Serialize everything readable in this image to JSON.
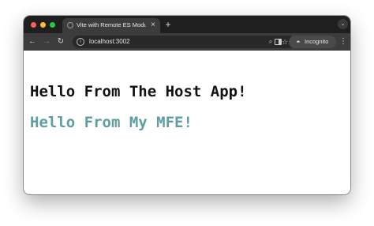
{
  "browser": {
    "tab": {
      "title": "Vite with Remote ES Modules",
      "close_glyph": "×",
      "favicon": "globe-icon"
    },
    "new_tab_glyph": "+",
    "tab_search_glyph": "⌄",
    "nav": {
      "back_glyph": "←",
      "forward_glyph": "→",
      "reload_glyph": "↻"
    },
    "address_bar": {
      "url": "localhost:3002",
      "site_info_glyph": "i"
    },
    "zoom_glyph": "⌕",
    "bookmark_glyph": "☆",
    "incognito": {
      "label": "Incognito",
      "glyph": "◓"
    },
    "menu_glyph": "⋮"
  },
  "page": {
    "host_heading": "Hello From The Host App!",
    "mfe_heading": "Hello From My MFE!"
  },
  "colors": {
    "mfe_heading": "#5f9ea0",
    "host_heading": "#111111",
    "titlebar": "#1f1f20",
    "toolbar": "#3c3c3c"
  }
}
